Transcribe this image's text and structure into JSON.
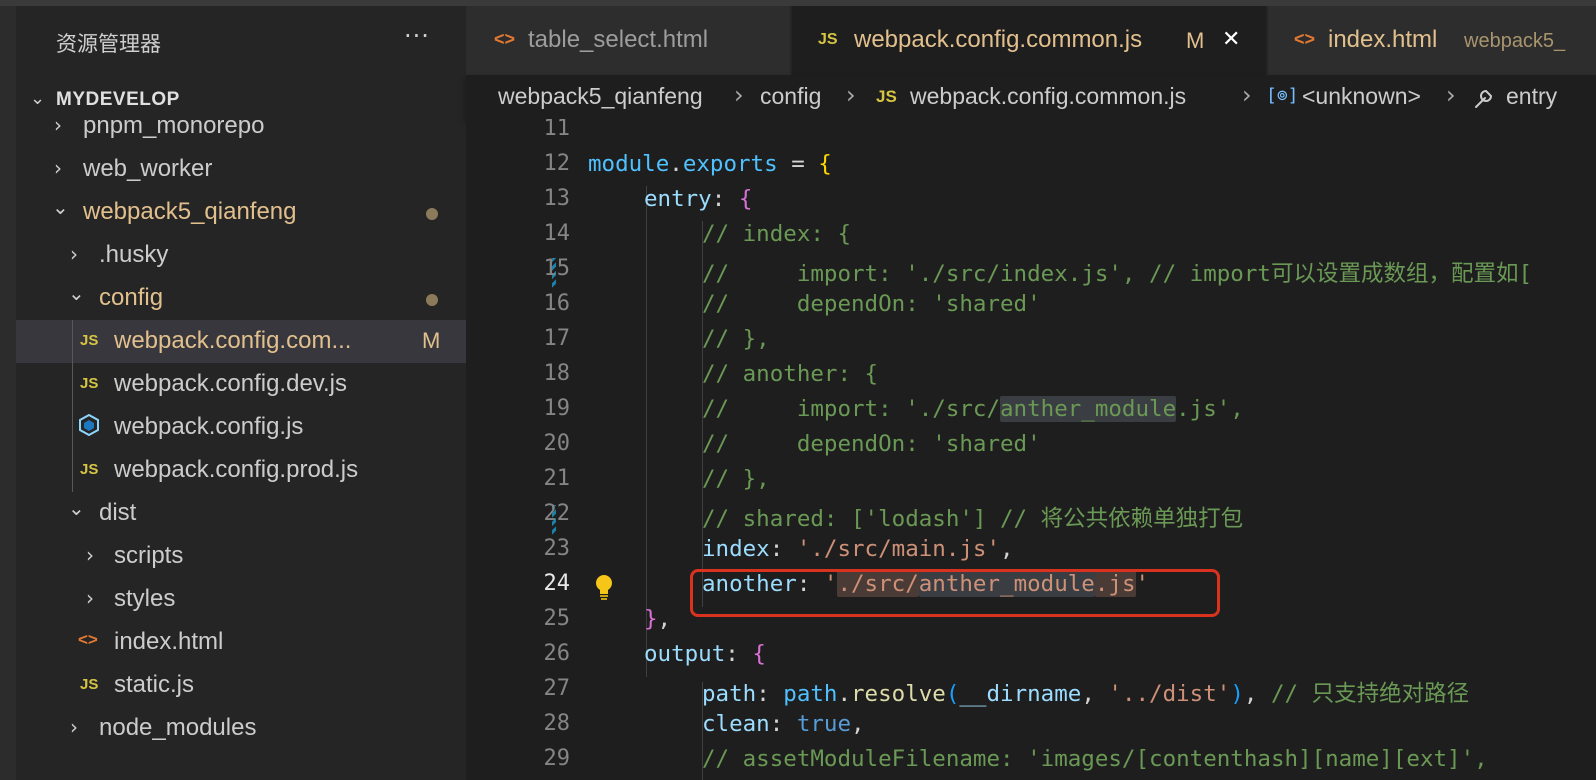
{
  "explorer": {
    "title": "资源管理器",
    "more": "···",
    "workspace": "MYDEVELOP",
    "items": [
      {
        "label": "pnpm_monorepo",
        "chevron": "›",
        "icon": ""
      },
      {
        "label": "web_worker",
        "chevron": "›",
        "icon": ""
      },
      {
        "label": "webpack5_qianfeng",
        "chevron": "⌄",
        "icon": "",
        "modified": true
      },
      {
        "label": ".husky",
        "chevron": "›",
        "icon": ""
      },
      {
        "label": "config",
        "chevron": "⌄",
        "icon": "",
        "modified": true
      },
      {
        "label": "webpack.config.com...",
        "chevron": "",
        "icon": "JS",
        "badge": "M"
      },
      {
        "label": "webpack.config.dev.js",
        "chevron": "",
        "icon": "JS"
      },
      {
        "label": "webpack.config.js",
        "chevron": "",
        "icon": "webpack-icon"
      },
      {
        "label": "webpack.config.prod.js",
        "chevron": "",
        "icon": "JS"
      },
      {
        "label": "dist",
        "chevron": "⌄",
        "icon": ""
      },
      {
        "label": "scripts",
        "chevron": "›",
        "icon": ""
      },
      {
        "label": "styles",
        "chevron": "›",
        "icon": ""
      },
      {
        "label": "index.html",
        "chevron": "",
        "icon": "<>"
      },
      {
        "label": "static.js",
        "chevron": "",
        "icon": "JS"
      },
      {
        "label": "node_modules",
        "chevron": "›",
        "icon": ""
      }
    ]
  },
  "tabs": [
    {
      "icon": "<>",
      "label": "table_select.html"
    },
    {
      "icon": "JS",
      "label": "webpack.config.common.js",
      "badge": "M",
      "close": "✕"
    },
    {
      "icon": "<>",
      "label": "index.html",
      "desc": "webpack5_"
    }
  ],
  "breadcrumb": {
    "root": "webpack5_qianfeng",
    "folder": "config",
    "file_icon": "JS",
    "file": "webpack.config.common.js",
    "symbol_icon": "[⊚]",
    "symbol": "<unknown>",
    "entry": "entry"
  },
  "editor": {
    "current_line": "24",
    "lines": [
      {
        "n": "11"
      },
      {
        "n": "12"
      },
      {
        "n": "13"
      },
      {
        "n": "14"
      },
      {
        "n": "15"
      },
      {
        "n": "16"
      },
      {
        "n": "17"
      },
      {
        "n": "18"
      },
      {
        "n": "19"
      },
      {
        "n": "20"
      },
      {
        "n": "21"
      },
      {
        "n": "22"
      },
      {
        "n": "23"
      },
      {
        "n": "24"
      },
      {
        "n": "25"
      },
      {
        "n": "26"
      },
      {
        "n": "27"
      },
      {
        "n": "28"
      },
      {
        "n": "29"
      }
    ],
    "code": {
      "l12_module": "module",
      "l12_dot": ".",
      "l12_exports": "exports",
      "l12_eq": " = ",
      "l12_brace": "{",
      "l13_entry": "entry",
      "l13_colon": ": ",
      "l13_brace": "{",
      "l14": "// index: {",
      "l15": "//     import: './src/index.js', // import可以设置成数组，配置如[",
      "l16": "//     dependOn: 'shared'",
      "l17": "// },",
      "l18": "// another: {",
      "l19_a": "//     import: './src/",
      "l19_b": "anther_module",
      "l19_c": ".js',",
      "l20": "//     dependOn: 'shared'",
      "l21": "// },",
      "l22": "// shared: ['lodash'] // 将公共依赖单独打包",
      "l23_key": "index",
      "l23_colon": ": ",
      "l23_val": "'./src/main.js'",
      "l23_comma": ",",
      "l24_key": "another",
      "l24_colon": ": ",
      "l24_q1": "'",
      "l24_p1": "./src/",
      "l24_p2": "anther_module",
      "l24_p3": ".js",
      "l24_q2": "'",
      "l25_brace": "}",
      "l25_comma": ",",
      "l26_output": "output",
      "l26_colon": ": ",
      "l26_brace": "{",
      "l27_path": "path",
      "l27_colon": ": ",
      "l27_pathobj": "path",
      "l27_dot": ".",
      "l27_resolve": "resolve",
      "l27_paren": "(",
      "l27_dirname": "__dirname",
      "l27_sep": ", ",
      "l27_str": "'../dist'",
      "l27_paren2": ")",
      "l27_comma": ", ",
      "l27_cmt": "// 只支持绝对路径",
      "l28_clean": "clean",
      "l28_colon": ": ",
      "l28_true": "true",
      "l28_comma": ",",
      "l29": "// assetModuleFilename: 'images/[contenthash][name][ext]',"
    }
  },
  "colors": {
    "accent_modified": "#e2c08d",
    "highlight_box": "#d9331f",
    "comment": "#6a9955",
    "string": "#ce9178"
  }
}
